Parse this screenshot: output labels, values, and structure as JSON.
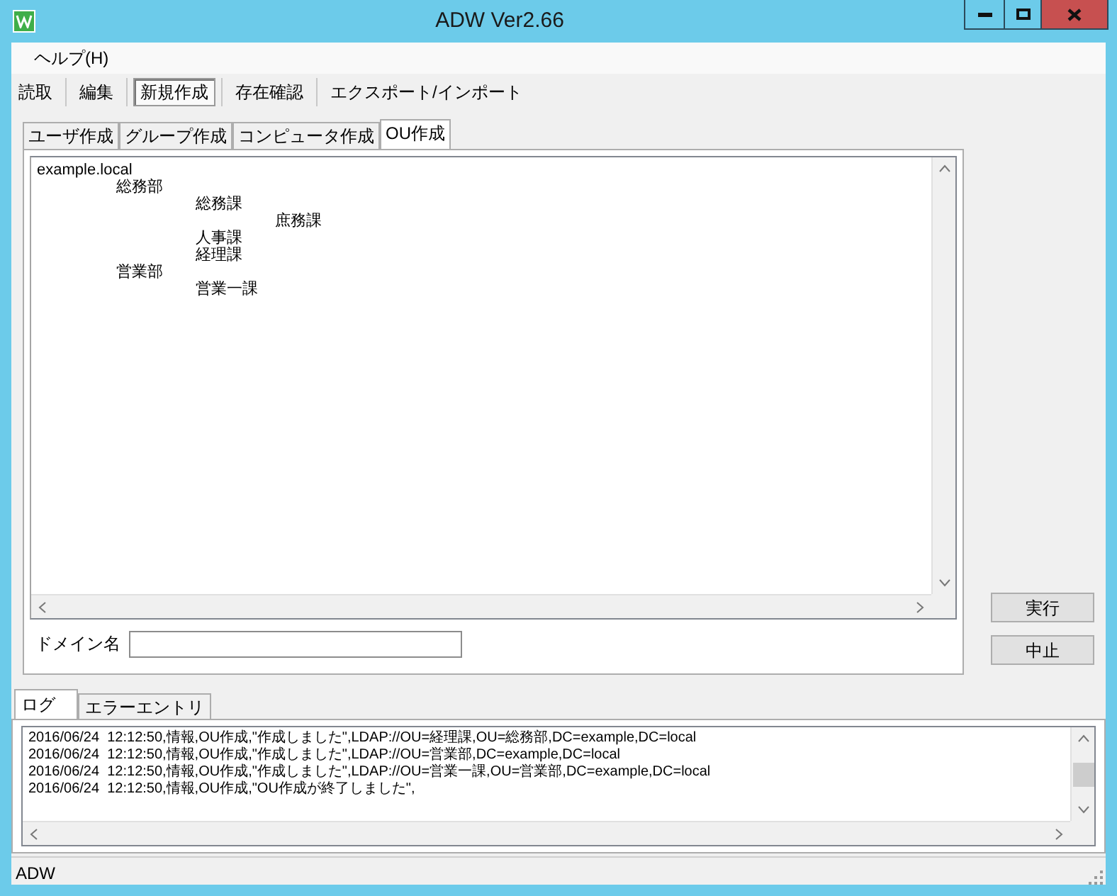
{
  "window": {
    "title": "ADW Ver2.66"
  },
  "menu": [
    "ヘルプ(H)"
  ],
  "toolbar": [
    {
      "label": "読取",
      "selected": false
    },
    {
      "label": "編集",
      "selected": false
    },
    {
      "label": "新規作成",
      "selected": true
    },
    {
      "label": "存在確認",
      "selected": false
    },
    {
      "label": "エクスポート/インポート",
      "selected": false
    }
  ],
  "tabs": [
    {
      "label": "ユーザ作成",
      "selected": false
    },
    {
      "label": "グループ作成",
      "selected": false
    },
    {
      "label": "コンピュータ作成",
      "selected": false
    },
    {
      "label": "OU作成",
      "selected": true
    }
  ],
  "tree": [
    {
      "label": "example.local",
      "children": [
        {
          "label": "総務部",
          "children": [
            {
              "label": "総務課",
              "children": [
                {
                  "label": "庶務課"
                }
              ]
            },
            {
              "label": "人事課"
            },
            {
              "label": "経理課"
            }
          ]
        },
        {
          "label": "営業部",
          "children": [
            {
              "label": "営業一課"
            }
          ]
        }
      ]
    }
  ],
  "domain_field": {
    "label": "ドメイン名"
  },
  "buttons": [
    "実行",
    "中止"
  ],
  "log_tabs": [
    {
      "label": "ログ",
      "selected": true
    },
    {
      "label": "エラーエントリ",
      "selected": false
    }
  ],
  "log_lines": [
    "2016/06/24  12:12:50,情報,OU作成,\"作成しました\",LDAP://OU=経理課,OU=総務部,DC=example,DC=local",
    "2016/06/24  12:12:50,情報,OU作成,\"作成しました\",LDAP://OU=営業部,DC=example,DC=local",
    "2016/06/24  12:12:50,情報,OU作成,\"作成しました\",LDAP://OU=営業一課,OU=営業部,DC=example,DC=local",
    "2016/06/24  12:12:50,情報,OU作成,\"OU作成が終了しました\","
  ],
  "status_bar": "ADW"
}
